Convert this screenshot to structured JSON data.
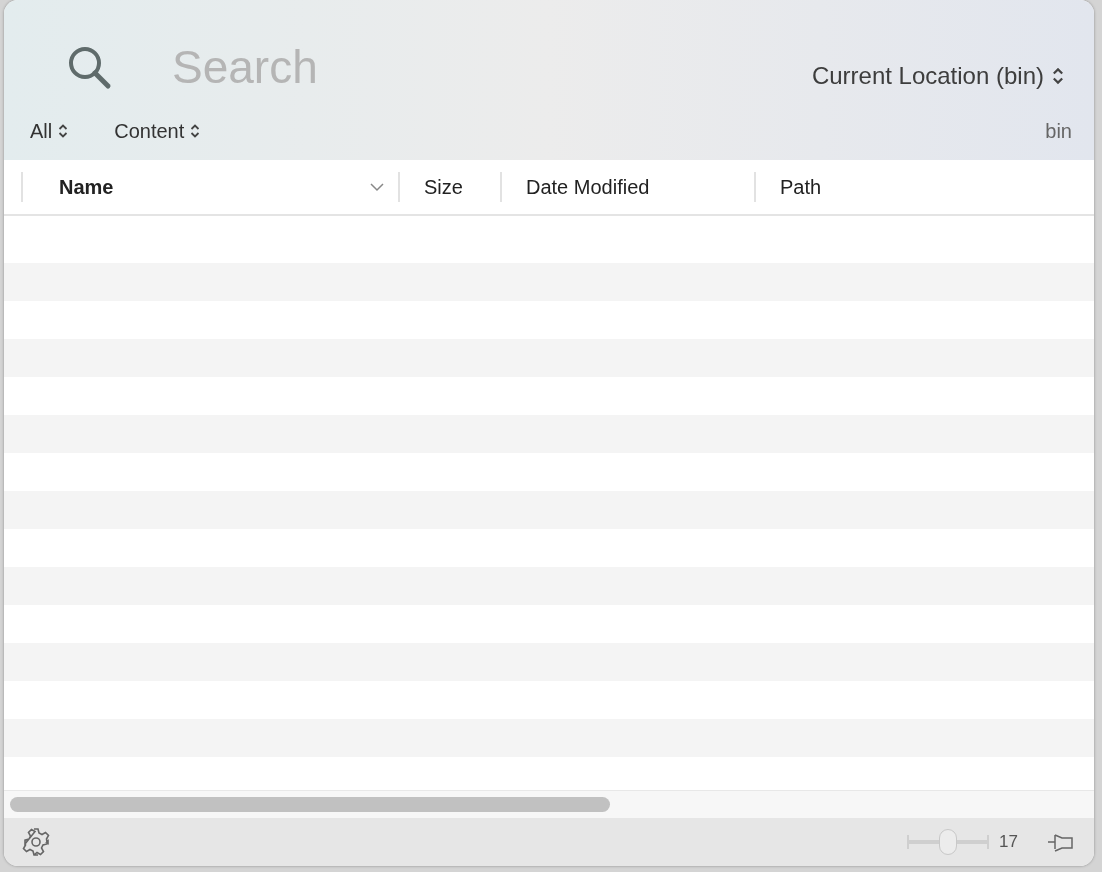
{
  "search": {
    "placeholder": "Search"
  },
  "scope_popup": {
    "label": "Current Location (bin)"
  },
  "filters": [
    {
      "label": "All"
    },
    {
      "label": "Content"
    }
  ],
  "location": "bin",
  "columns": [
    {
      "label": "Name",
      "sorted": true
    },
    {
      "label": "Size",
      "sorted": false
    },
    {
      "label": "Date Modified",
      "sorted": false
    },
    {
      "label": "Path",
      "sorted": false
    }
  ],
  "footer": {
    "zoom_slider": {
      "level": 0.5
    },
    "zoom_reading": "17"
  }
}
